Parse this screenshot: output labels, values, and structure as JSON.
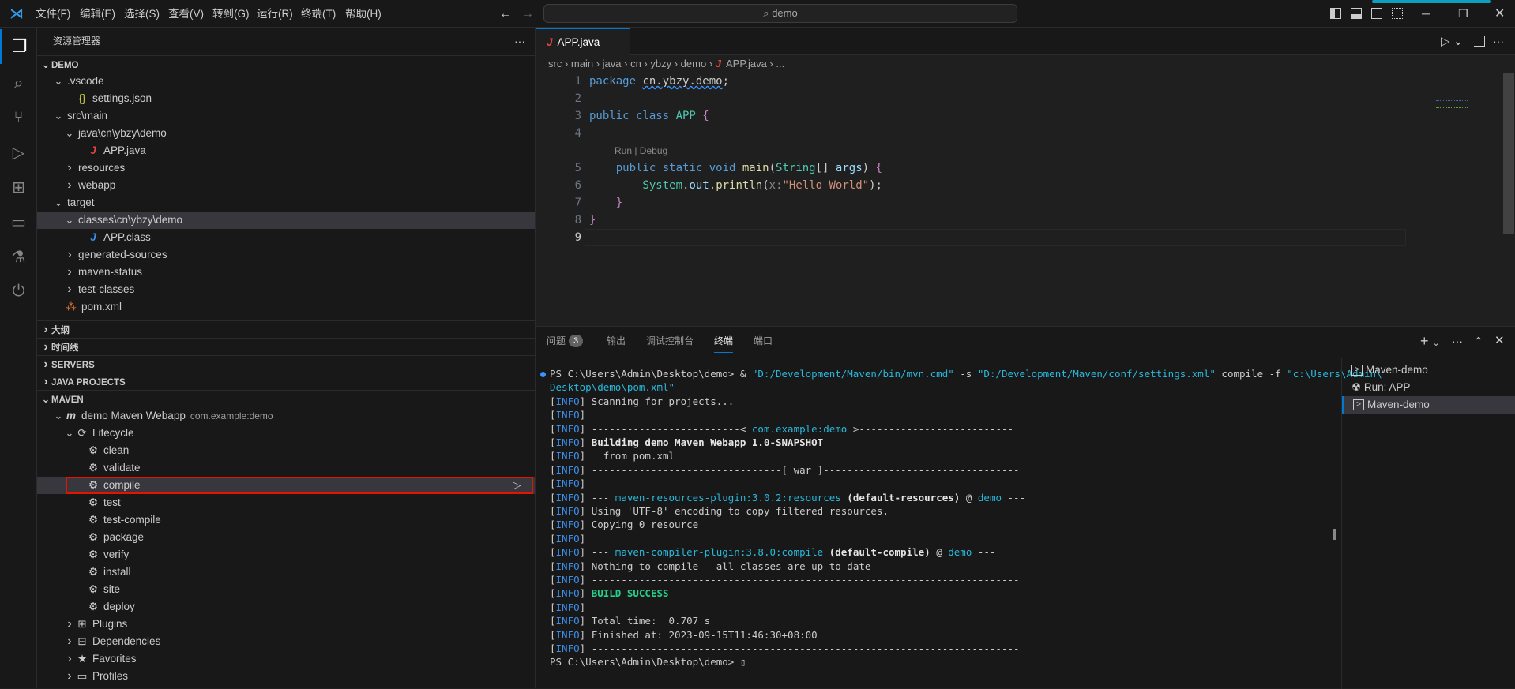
{
  "menu": [
    "文件(F)",
    "编辑(E)",
    "选择(S)",
    "查看(V)",
    "转到(G)",
    "运行(R)",
    "终端(T)",
    "帮助(H)"
  ],
  "search": "demo",
  "sidebar": {
    "title": "资源管理器",
    "more": "···",
    "rows": [
      {
        "label": "DEMO",
        "depth": 0,
        "tw": "v",
        "sec": true
      },
      {
        "label": ".vscode",
        "depth": 1,
        "tw": "v"
      },
      {
        "label": "settings.json",
        "depth": 2,
        "icon": "{}",
        "iconColor": "#cbcb41"
      },
      {
        "label": "src\\main",
        "depth": 1,
        "tw": "v"
      },
      {
        "label": "java\\cn\\ybzy\\demo",
        "depth": 2,
        "tw": "v"
      },
      {
        "label": "APP.java",
        "depth": 3,
        "icon": "J",
        "iconColor": "#e0443e"
      },
      {
        "label": "resources",
        "depth": 2,
        "tw": ">"
      },
      {
        "label": "webapp",
        "depth": 2,
        "tw": ">"
      },
      {
        "label": "target",
        "depth": 1,
        "tw": "v"
      },
      {
        "label": "classes\\cn\\ybzy\\demo",
        "depth": 2,
        "tw": "v",
        "sel": true
      },
      {
        "label": "APP.class",
        "depth": 3,
        "icon": "J",
        "iconColor": "#3b8eea"
      },
      {
        "label": "generated-sources",
        "depth": 2,
        "tw": ">"
      },
      {
        "label": "maven-status",
        "depth": 2,
        "tw": ">"
      },
      {
        "label": "test-classes",
        "depth": 2,
        "tw": ">"
      },
      {
        "label": "pom.xml",
        "depth": 1,
        "icon": "⁂",
        "iconColor": "#e37933"
      }
    ],
    "sections": [
      "大纲",
      "时间线",
      "SERVERS",
      "JAVA PROJECTS",
      "MAVEN"
    ],
    "maven": [
      {
        "label": "demo Maven Webapp",
        "desc": "com.example:demo",
        "depth": 1,
        "tw": "v",
        "icon": "m"
      },
      {
        "label": "Lifecycle",
        "depth": 2,
        "tw": "v",
        "icon": "⟳"
      },
      {
        "label": "clean",
        "depth": 3,
        "icon": "⚙"
      },
      {
        "label": "validate",
        "depth": 3,
        "icon": "⚙"
      },
      {
        "label": "compile",
        "depth": 3,
        "icon": "⚙",
        "sel": true,
        "run": "▷"
      },
      {
        "label": "test",
        "depth": 3,
        "icon": "⚙"
      },
      {
        "label": "test-compile",
        "depth": 3,
        "icon": "⚙"
      },
      {
        "label": "package",
        "depth": 3,
        "icon": "⚙"
      },
      {
        "label": "verify",
        "depth": 3,
        "icon": "⚙"
      },
      {
        "label": "install",
        "depth": 3,
        "icon": "⚙"
      },
      {
        "label": "site",
        "depth": 3,
        "icon": "⚙"
      },
      {
        "label": "deploy",
        "depth": 3,
        "icon": "⚙"
      },
      {
        "label": "Plugins",
        "depth": 2,
        "tw": ">",
        "icon": "⊞"
      },
      {
        "label": "Dependencies",
        "depth": 2,
        "tw": ">",
        "icon": "⊟"
      },
      {
        "label": "Favorites",
        "depth": 2,
        "tw": ">",
        "icon": "★"
      },
      {
        "label": "Profiles",
        "depth": 2,
        "tw": ">",
        "icon": "▭"
      }
    ]
  },
  "editor": {
    "tab": "APP.java",
    "breadcrumbs": [
      "src",
      "main",
      "java",
      "cn",
      "ybzy",
      "demo",
      "APP.java",
      "..."
    ],
    "codelens": "Run | Debug",
    "lines": [
      {
        "n": "1",
        "seg": [
          [
            "package ",
            "kw"
          ],
          [
            "cn.ybzy.demo",
            ""
          ],
          [
            ";",
            ""
          ]
        ]
      },
      {
        "n": "2",
        "seg": []
      },
      {
        "n": "3",
        "seg": [
          [
            "public class ",
            "kw"
          ],
          [
            "APP ",
            "cls"
          ],
          [
            "{",
            "kw2"
          ]
        ]
      },
      {
        "n": "4",
        "seg": []
      },
      {
        "n": "5",
        "seg": [
          [
            "    public static void ",
            "kw"
          ],
          [
            "main",
            "fn"
          ],
          [
            "(",
            ""
          ],
          [
            "String",
            "cls"
          ],
          [
            "[] ",
            ""
          ],
          [
            "args",
            "var"
          ],
          [
            ") ",
            ""
          ],
          [
            "{",
            "kw2"
          ]
        ]
      },
      {
        "n": "6",
        "seg": [
          [
            "        System",
            "cls"
          ],
          [
            ".",
            ""
          ],
          [
            "out",
            "var"
          ],
          [
            ".",
            ""
          ],
          [
            "println",
            "fn"
          ],
          [
            "(",
            ""
          ],
          [
            "x:",
            "hint"
          ],
          [
            "\"Hello World\"",
            "str"
          ],
          [
            ");",
            ""
          ]
        ]
      },
      {
        "n": "7",
        "seg": [
          [
            "    }",
            "kw2"
          ]
        ]
      },
      {
        "n": "8",
        "seg": [
          [
            "}",
            "kw2"
          ]
        ]
      },
      {
        "n": "9",
        "seg": []
      }
    ]
  },
  "panel": {
    "tabs": [
      "问题",
      "输出",
      "调试控制台",
      "终端",
      "端口"
    ],
    "problems_count": "3",
    "active_tab": "终端",
    "terminal_lines": [
      [
        [
          "PS C:\\Users\\Admin\\Desktop\\demo> & ",
          ""
        ],
        [
          "\"D:/Development/Maven/bin/mvn.cmd\"",
          "cyan"
        ],
        [
          " -s ",
          ""
        ],
        [
          "\"D:/Development/Maven/conf/settings.xml\"",
          "cyan"
        ],
        [
          " compile -f ",
          ""
        ],
        [
          "\"c:\\Users\\Admin\\",
          "cyan"
        ]
      ],
      [
        [
          "Desktop\\demo\\pom.xml\"",
          "cyan"
        ]
      ],
      [
        [
          "[",
          ""
        ],
        [
          "INFO",
          "info"
        ],
        [
          "] Scanning for projects...",
          ""
        ]
      ],
      [
        [
          "[",
          ""
        ],
        [
          "INFO",
          "info"
        ],
        [
          "]",
          ""
        ]
      ],
      [
        [
          "[",
          ""
        ],
        [
          "INFO",
          "info"
        ],
        [
          "] -------------------------< ",
          ""
        ],
        [
          "com.example:demo",
          "cyan"
        ],
        [
          " >--------------------------",
          ""
        ]
      ],
      [
        [
          "[",
          ""
        ],
        [
          "INFO",
          "info"
        ],
        [
          "] ",
          ""
        ],
        [
          "Building demo Maven Webapp 1.0-SNAPSHOT",
          "bold"
        ]
      ],
      [
        [
          "[",
          ""
        ],
        [
          "INFO",
          "info"
        ],
        [
          "]   from pom.xml",
          ""
        ]
      ],
      [
        [
          "[",
          ""
        ],
        [
          "INFO",
          "info"
        ],
        [
          "] --------------------------------[ war ]---------------------------------",
          ""
        ]
      ],
      [
        [
          "[",
          ""
        ],
        [
          "INFO",
          "info"
        ],
        [
          "]",
          ""
        ]
      ],
      [
        [
          "[",
          ""
        ],
        [
          "INFO",
          "info"
        ],
        [
          "] --- ",
          ""
        ],
        [
          "maven-resources-plugin:3.0.2:resources",
          "cyan"
        ],
        [
          " ",
          ""
        ],
        [
          "(default-resources)",
          "bold"
        ],
        [
          " @ ",
          ""
        ],
        [
          "demo",
          "cyan"
        ],
        [
          " ---",
          ""
        ]
      ],
      [
        [
          "[",
          ""
        ],
        [
          "INFO",
          "info"
        ],
        [
          "] Using 'UTF-8' encoding to copy filtered resources.",
          ""
        ]
      ],
      [
        [
          "[",
          ""
        ],
        [
          "INFO",
          "info"
        ],
        [
          "] Copying 0 resource",
          ""
        ]
      ],
      [
        [
          "[",
          ""
        ],
        [
          "INFO",
          "info"
        ],
        [
          "]",
          ""
        ]
      ],
      [
        [
          "[",
          ""
        ],
        [
          "INFO",
          "info"
        ],
        [
          "] --- ",
          ""
        ],
        [
          "maven-compiler-plugin:3.8.0:compile",
          "cyan"
        ],
        [
          " ",
          ""
        ],
        [
          "(default-compile)",
          "bold"
        ],
        [
          " @ ",
          ""
        ],
        [
          "demo",
          "cyan"
        ],
        [
          " ---",
          ""
        ]
      ],
      [
        [
          "[",
          ""
        ],
        [
          "INFO",
          "info"
        ],
        [
          "] Nothing to compile - all classes are up to date",
          ""
        ]
      ],
      [
        [
          "[",
          ""
        ],
        [
          "INFO",
          "info"
        ],
        [
          "] ------------------------------------------------------------------------",
          ""
        ]
      ],
      [
        [
          "[",
          ""
        ],
        [
          "INFO",
          "info"
        ],
        [
          "] ",
          ""
        ],
        [
          "BUILD SUCCESS",
          "green"
        ]
      ],
      [
        [
          "[",
          ""
        ],
        [
          "INFO",
          "info"
        ],
        [
          "] ------------------------------------------------------------------------",
          ""
        ]
      ],
      [
        [
          "[",
          ""
        ],
        [
          "INFO",
          "info"
        ],
        [
          "] Total time:  0.707 s",
          ""
        ]
      ],
      [
        [
          "[",
          ""
        ],
        [
          "INFO",
          "info"
        ],
        [
          "] Finished at: 2023-09-15T11:46:30+08:00",
          ""
        ]
      ],
      [
        [
          "[",
          ""
        ],
        [
          "INFO",
          "info"
        ],
        [
          "] ------------------------------------------------------------------------",
          ""
        ]
      ],
      [
        [
          "PS C:\\Users\\Admin\\Desktop\\demo> ",
          ""
        ],
        [
          "▯",
          ""
        ]
      ]
    ],
    "terminals": [
      {
        "label": "Maven-demo",
        "icon": "terminal"
      },
      {
        "label": "Run: APP",
        "icon": "debug"
      },
      {
        "label": "Maven-demo",
        "icon": "terminal",
        "sel": true
      }
    ]
  }
}
